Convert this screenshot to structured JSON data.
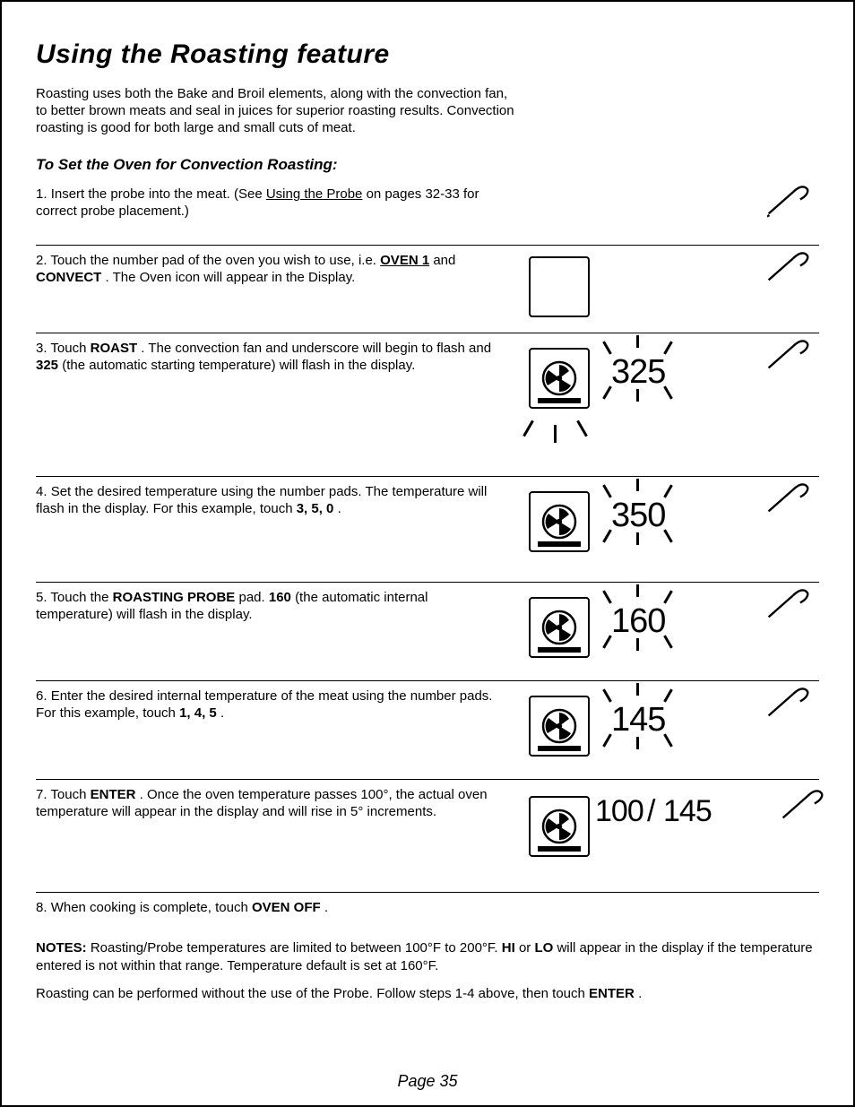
{
  "title": "Using the Roasting feature",
  "intro": "Roasting uses both the Bake and Broil elements, along with the convection fan, to better brown meats and seal in juices for superior roasting results. Convection roasting is good for both large and small cuts of meat.",
  "section_heading": "To Set the Oven for Convection Roasting:",
  "step1": {
    "text_a": "Insert the probe into the meat. (See ",
    "text_link": "Using the Probe",
    "text_b": " on pages 32-33 for correct probe placement.)"
  },
  "step2": {
    "text_a": "Touch the number pad of the oven you wish to use, i.e. ",
    "text_oven": "OVEN 1",
    "text_b": " and ",
    "text_convect": "CONVECT",
    "text_c": ". The Oven icon will appear in the Display."
  },
  "step3": {
    "text_a": "Touch ",
    "text_roast": "ROAST",
    "text_b": ". The convection fan and underscore will begin to flash and ",
    "text_default": "325",
    "text_c": " (the automatic starting temperature) will flash in the display.",
    "temp": "325"
  },
  "step4": {
    "text_a": "Set the desired temperature using the number pads. The temperature will flash in the display. For this example, touch ",
    "text_keys": "3, 5, 0",
    "text_b": ".",
    "temp": "350"
  },
  "step5": {
    "text_a": "Touch the ",
    "text_probe": "ROASTING PROBE",
    "text_b": " pad. ",
    "text_default": "160",
    "text_c": " (the automatic internal temperature) will flash in the display.",
    "temp": "160"
  },
  "step6": {
    "text_a": "Enter the desired internal temperature of the meat using the number pads. For this example, touch ",
    "text_keys": "1, 4, 5",
    "text_b": ".",
    "temp": "145"
  },
  "step7": {
    "text_a": "Touch ",
    "text_enter": "ENTER",
    "text_b": ". Once the oven temperature passes 100°, the actual oven temperature will appear in the display and will rise in 5° increments.",
    "temp_a": "100",
    "temp_slash": "/",
    "temp_b": "145"
  },
  "step8": {
    "text_a": "When cooking is complete, touch ",
    "text_off": "OVEN OFF",
    "text_b": "."
  },
  "notes_label": "NOTES:",
  "note1_a": "Roasting/Probe temperatures are limited to between 100°F to 200°F. ",
  "note1_b": "HI",
  "note1_c": " or ",
  "note1_d": "LO",
  "note1_e": " will appear in the display if the temperature entered is not within that range. Temperature default is set at 160°F.",
  "note2_a": "Roasting can be performed without the use of the Probe. Follow steps 1-4 above, then touch ",
  "note2_b": "ENTER",
  "note2_c": ".",
  "footer": "Page 35"
}
